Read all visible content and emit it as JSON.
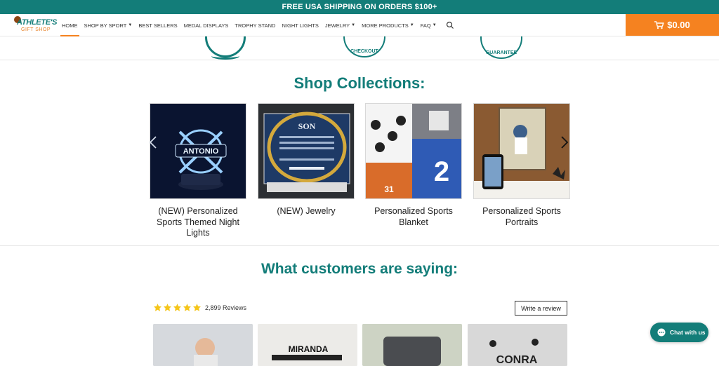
{
  "announcement": "FREE USA SHIPPING ON ORDERS $100+",
  "logo": {
    "line1": "ATHLETE'S",
    "line2": "GIFT SHOP"
  },
  "nav": {
    "items": [
      {
        "label": "HOME",
        "active": true,
        "dropdown": false
      },
      {
        "label": "SHOP BY SPORT",
        "active": false,
        "dropdown": true
      },
      {
        "label": "BEST SELLERS",
        "active": false,
        "dropdown": false
      },
      {
        "label": "MEDAL DISPLAYS",
        "active": false,
        "dropdown": false
      },
      {
        "label": "TROPHY STAND",
        "active": false,
        "dropdown": false
      },
      {
        "label": "NIGHT LIGHTS",
        "active": false,
        "dropdown": false
      },
      {
        "label": "JEWELRY",
        "active": false,
        "dropdown": true
      },
      {
        "label": "MORE PRODUCTS",
        "active": false,
        "dropdown": true
      },
      {
        "label": "FAQ",
        "active": false,
        "dropdown": true
      }
    ],
    "search_icon": "search-icon"
  },
  "cart": {
    "total": "$0.00",
    "icon": "cart-icon"
  },
  "badges": {
    "checkout": "CHECKOUT",
    "guarantee": "GUARANTEE"
  },
  "collections": {
    "title": "Shop Collections:",
    "items": [
      {
        "name": "(NEW) Personalized Sports Themed Night Lights",
        "image_text": "ANTONIO"
      },
      {
        "name": "(NEW) Jewelry",
        "image_text": "SON"
      },
      {
        "name": "Personalized Sports Blanket",
        "image_text": "31"
      },
      {
        "name": "Personalized Sports Portraits"
      }
    ]
  },
  "reviews": {
    "title": "What customers are saying:",
    "rating": 5,
    "count": "2,899 Reviews",
    "write_label": "Write a review",
    "thumbs": [
      {
        "text": ""
      },
      {
        "text": "MIRANDA"
      },
      {
        "text": ""
      },
      {
        "text": "CONRA"
      }
    ]
  },
  "chat": {
    "label": "Chat with us"
  },
  "colors": {
    "brand": "#137d79",
    "accent": "#f58220"
  }
}
